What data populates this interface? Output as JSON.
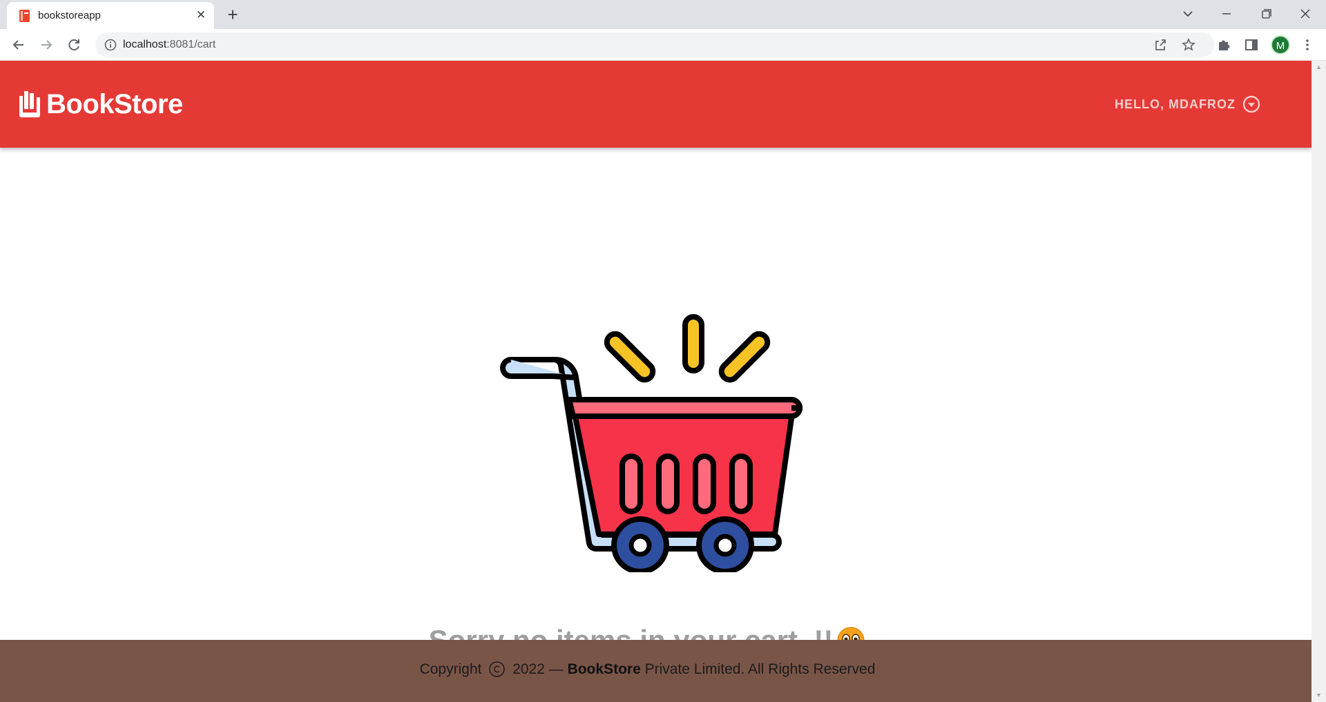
{
  "browser": {
    "tab_title": "bookstoreapp",
    "url_host": "localhost",
    "url_path": ":8081/cart",
    "profile_initial": "M",
    "icons": {
      "tab_favicon": "book-icon",
      "tab_close": "close-icon",
      "new_tab": "plus-icon",
      "back": "arrow-left-icon",
      "forward": "arrow-right-icon",
      "reload": "reload-icon",
      "site_info": "info-icon",
      "share": "share-icon",
      "bookmark": "star-icon",
      "extensions": "puzzle-icon",
      "side_panel": "side-panel-icon",
      "menu": "kebab-menu-icon",
      "tab_search": "chevron-down-icon",
      "minimize": "minimize-icon",
      "restore": "restore-icon",
      "close_window": "close-icon"
    }
  },
  "header": {
    "brand": "BookStore",
    "user_greeting": "HELLO, MDAFROZ",
    "icons": {
      "brand": "books-icon",
      "user_caret": "caret-down-circle-icon"
    },
    "colors": {
      "background": "#e53935",
      "text": "#ffffff"
    }
  },
  "main": {
    "empty_message": "Sorry no items in your cart..!!",
    "icons": {
      "illustration": "shopping-cart-icon",
      "emoji": "anxious-face-icon"
    }
  },
  "footer": {
    "prefix": "Copyright",
    "year_text": "2022 —",
    "brand": "BookStore",
    "suffix": "Private Limited. All Rights Reserved",
    "icons": {
      "copyright": "copyright-icon"
    },
    "colors": {
      "background": "#795548"
    }
  }
}
